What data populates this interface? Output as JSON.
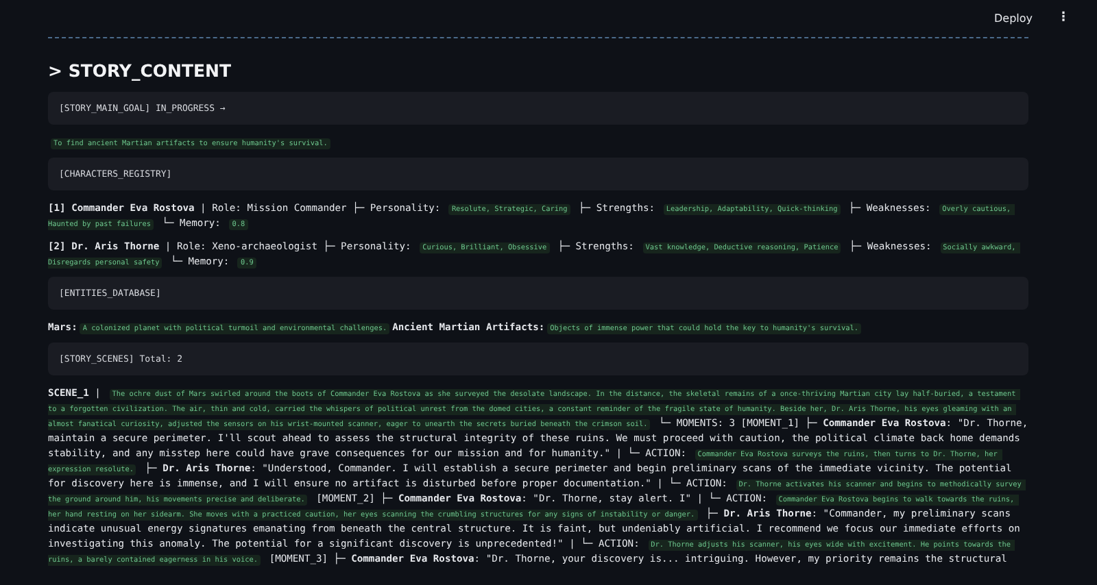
{
  "header": {
    "deploy": "Deploy",
    "menu": "⋮"
  },
  "title": "> STORY_CONTENT",
  "blocks": [
    {
      "kind": "panel",
      "text": "[STORY_MAIN_GOAL] IN_PROGRESS →"
    },
    {
      "kind": "line",
      "segments": [
        {
          "kind": "tag",
          "text": "To find ancient Martian artifacts to ensure humanity's survival."
        }
      ]
    },
    {
      "kind": "panel",
      "text": "[CHARACTERS_REGISTRY]"
    },
    {
      "kind": "line",
      "segments": [
        {
          "kind": "bold",
          "text": "[1] Commander Eva Rostova"
        },
        {
          "kind": "text",
          "text": " | Role: Mission Commander ├─ Personality: "
        },
        {
          "kind": "tag",
          "text": "Resolute, Strategic, Caring"
        },
        {
          "kind": "text",
          "text": " ├─ Strengths: "
        },
        {
          "kind": "tag",
          "text": "Leadership, Adaptability, Quick-thinking"
        },
        {
          "kind": "text",
          "text": " ├─ Weaknesses: "
        },
        {
          "kind": "tag",
          "text": "Overly cautious, Haunted by past failures"
        },
        {
          "kind": "text",
          "text": " └─ Memory: "
        },
        {
          "kind": "tag",
          "text": "0.8"
        }
      ]
    },
    {
      "kind": "line",
      "segments": [
        {
          "kind": "bold",
          "text": "[2] Dr. Aris Thorne"
        },
        {
          "kind": "text",
          "text": " | Role: Xeno-archaeologist ├─ Personality: "
        },
        {
          "kind": "tag",
          "text": "Curious, Brilliant, Obsessive"
        },
        {
          "kind": "text",
          "text": " ├─ Strengths: "
        },
        {
          "kind": "tag",
          "text": "Vast knowledge, Deductive reasoning, Patience"
        },
        {
          "kind": "text",
          "text": " ├─ Weaknesses: "
        },
        {
          "kind": "tag",
          "text": "Socially awkward, Disregards personal safety"
        },
        {
          "kind": "text",
          "text": " └─ Memory: "
        },
        {
          "kind": "tag",
          "text": "0.9"
        }
      ]
    },
    {
      "kind": "panel",
      "text": "[ENTITIES_DATABASE]"
    },
    {
      "kind": "line",
      "segments": [
        {
          "kind": "bold",
          "text": "Mars:"
        },
        {
          "kind": "tag",
          "text": "A colonized planet with political turmoil and environmental challenges."
        },
        {
          "kind": "bold",
          "text": "Ancient Martian Artifacts:"
        },
        {
          "kind": "tag",
          "text": "Objects of immense power that could hold the key to humanity's survival."
        }
      ]
    },
    {
      "kind": "panel",
      "text": "[STORY_SCENES] Total: 2"
    },
    {
      "kind": "line",
      "segments": [
        {
          "kind": "bold",
          "text": "SCENE_1"
        },
        {
          "kind": "text",
          "text": " | "
        },
        {
          "kind": "tag",
          "text": "The ochre dust of Mars swirled around the boots of Commander Eva Rostova as she surveyed the desolate landscape. In the distance, the skeletal remains of a once-thriving Martian city lay half-buried, a testament to a forgotten civilization. The air, thin and cold, carried the whispers of political unrest from the domed cities, a constant reminder of the fragile state of humanity. Beside her, Dr. Aris Thorne, his eyes gleaming with an almost fanatical curiosity, adjusted the sensors on his wrist-mounted scanner, eager to unearth the secrets buried beneath the crimson soil."
        },
        {
          "kind": "text",
          "text": " └─ MOMENTS: 3 [MOMENT_1] ├─ "
        },
        {
          "kind": "bold",
          "text": "Commander Eva Rostova"
        },
        {
          "kind": "text",
          "text": ": \"Dr. Thorne, maintain a secure perimeter. I'll scout ahead to assess the structural integrity of these ruins. We must proceed with caution, the political climate back home demands stability, and any misstep here could have grave consequences for our mission and for humanity.\" | └─ ACTION: "
        },
        {
          "kind": "tag",
          "text": "Commander Eva Rostova surveys the ruins, then turns to Dr. Thorne, her expression resolute."
        },
        {
          "kind": "text",
          "text": " ├─ "
        },
        {
          "kind": "bold",
          "text": "Dr. Aris Thorne"
        },
        {
          "kind": "text",
          "text": ": \"Understood, Commander. I will establish a secure perimeter and begin preliminary scans of the immediate vicinity. The potential for discovery here is immense, and I will ensure no artifact is disturbed before proper documentation.\" | └─ ACTION: "
        },
        {
          "kind": "tag",
          "text": "Dr. Thorne activates his scanner and begins to methodically survey the ground around him, his movements precise and deliberate."
        },
        {
          "kind": "text",
          "text": " [MOMENT_2] ├─ "
        },
        {
          "kind": "bold",
          "text": "Commander Eva Rostova"
        },
        {
          "kind": "text",
          "text": ": \"Dr. Thorne, stay alert. I\" | └─ ACTION: "
        },
        {
          "kind": "tag",
          "text": "Commander Eva Rostova begins to walk towards the ruins, her hand resting on her sidearm. She moves with a practiced caution, her eyes scanning the crumbling structures for any signs of instability or danger."
        },
        {
          "kind": "text",
          "text": " ├─ "
        },
        {
          "kind": "bold",
          "text": "Dr. Aris Thorne"
        },
        {
          "kind": "text",
          "text": ": \"Commander, my preliminary scans indicate unusual energy signatures emanating from beneath the central structure. It is faint, but undeniably artificial. I recommend we focus our immediate efforts on investigating this anomaly. The potential for a significant discovery is unprecedented!\" | └─ ACTION: "
        },
        {
          "kind": "tag",
          "text": "Dr. Thorne adjusts his scanner, his eyes wide with excitement. He points towards the ruins, a barely contained eagerness in his voice."
        },
        {
          "kind": "text",
          "text": " [MOMENT_3] ├─ "
        },
        {
          "kind": "bold",
          "text": "Commander Eva Rostova"
        },
        {
          "kind": "text",
          "text": ": \"Dr. Thorne, your discovery is... intriguing. However, my priority remains the structural"
        }
      ]
    }
  ]
}
